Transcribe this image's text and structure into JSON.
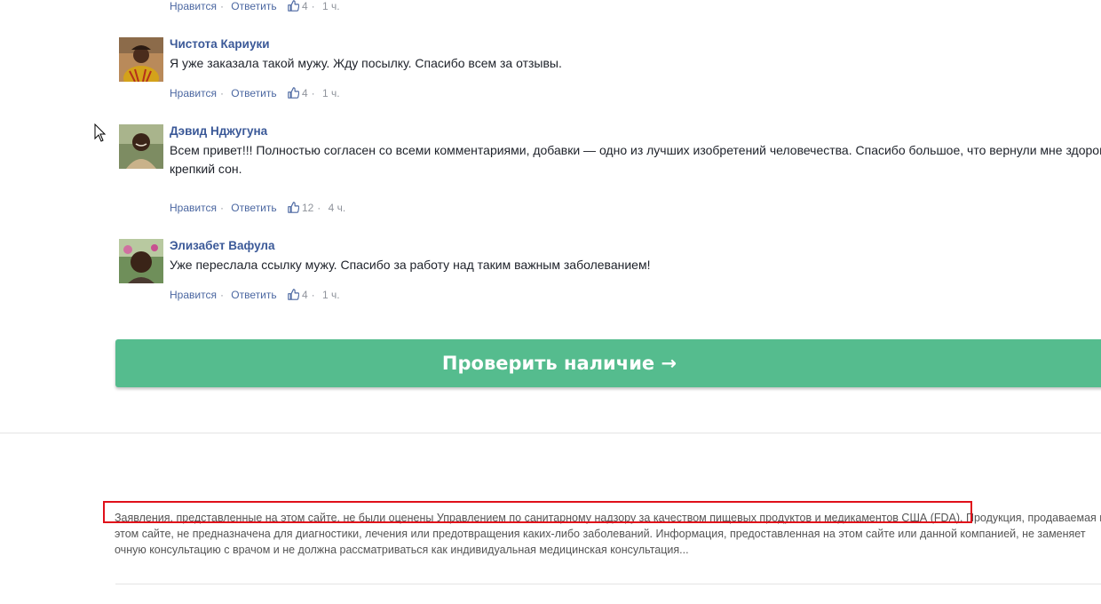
{
  "top_comment_actions": {
    "like": "Нравится",
    "reply": "Ответить",
    "likes": "4",
    "time": "1 ч."
  },
  "comments": [
    {
      "name": "Чистота Кариуки",
      "text": "Я уже заказала такой мужу. Жду посылку. Спасибо всем за отзывы.",
      "like": "Нравится",
      "reply": "Ответить",
      "likes": "4",
      "time": "1 ч."
    },
    {
      "name": "Дэвид Нджугуна",
      "text": "Всем привет!!! Полностью согласен со всеми комментариями, добавки — одно из лучших изобретений человечества. Спасибо большое, что вернули мне здоровый и\nкрепкий сон.",
      "like": "Нравится",
      "reply": "Ответить",
      "likes": "12",
      "time": "4 ч."
    },
    {
      "name": "Элизабет Вафула",
      "text": "Уже переслала ссылку мужу. Спасибо за работу над таким важным заболеванием!",
      "like": "Нравится",
      "reply": "Ответить",
      "likes": "4",
      "time": "1 ч."
    }
  ],
  "cta": {
    "label": "Проверить наличие →",
    "color": "#55bc8e"
  },
  "disclaimer": {
    "text": "Заявления, представленные на этом сайте, не были оценены Управлением по санитарному надзору за качеством пищевых продуктов и медикаментов США (FDA). Продукция, продаваемая на этом сайте, не предназначена для диагностики, лечения или предотвращения каких-либо заболеваний. Информация, предоставленная на этом сайте или данной компанией, не заменяет очную консультацию с врачом и не должна рассматриваться как индивидуальная медицинская консультация..."
  },
  "colors": {
    "link": "#4b67a1",
    "name": "#3b5998",
    "highlight": "#e0101a"
  },
  "icons": {
    "like": "thumbs-up-icon",
    "cursor": "mouse-pointer-icon"
  }
}
